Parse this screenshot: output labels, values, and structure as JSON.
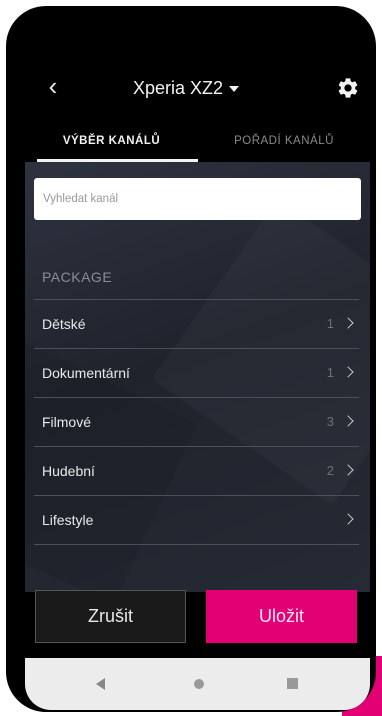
{
  "header": {
    "title": "Xperia XZ2",
    "back_icon": "chevron-left-icon",
    "dropdown_icon": "caret-down-icon",
    "settings_icon": "gear-icon"
  },
  "tabs": [
    {
      "label": "VÝBĚR KANÁLŮ",
      "active": true
    },
    {
      "label": "POŘADÍ KANÁLŮ",
      "active": false
    }
  ],
  "search": {
    "placeholder": "Vyhledat kanál",
    "value": ""
  },
  "package": {
    "header": "PACKAGE",
    "items": [
      {
        "label": "Dětské",
        "count": "1"
      },
      {
        "label": "Dokumentární",
        "count": "1"
      },
      {
        "label": "Filmové",
        "count": "3"
      },
      {
        "label": "Hudební",
        "count": "2"
      },
      {
        "label": "Lifestyle",
        "count": ""
      }
    ]
  },
  "actions": {
    "cancel_label": "Zrušit",
    "save_label": "Uložit"
  },
  "colors": {
    "accent": "#e20074",
    "background": "#000000",
    "content_bg": "#262a33"
  },
  "navbar": {
    "icons": [
      "nav-back-icon",
      "nav-home-icon",
      "nav-recent-icon"
    ]
  }
}
